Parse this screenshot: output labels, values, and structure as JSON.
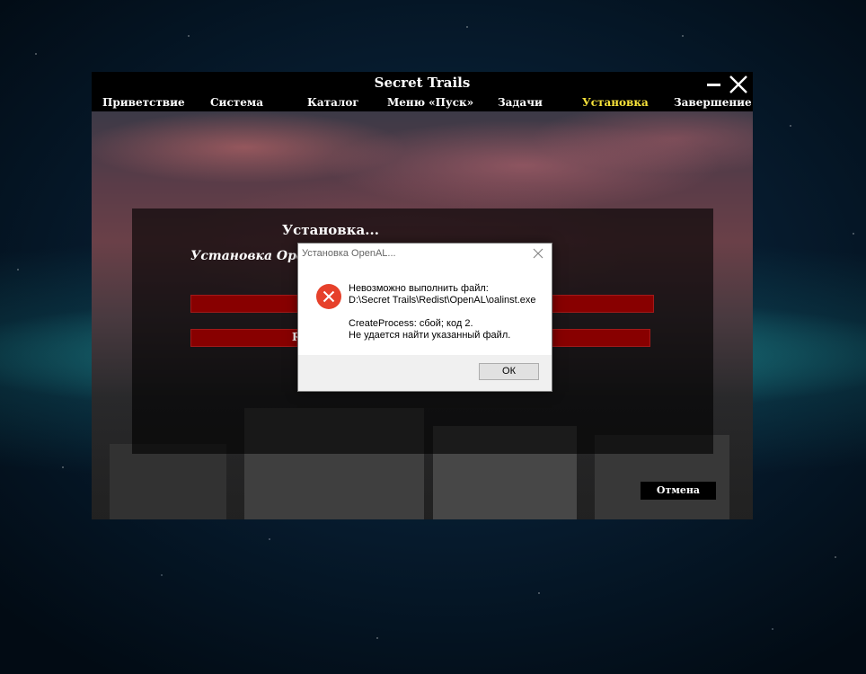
{
  "window": {
    "title": "Secret Trails"
  },
  "nav": {
    "items": [
      {
        "label": "Приветствие"
      },
      {
        "label": "Система"
      },
      {
        "label": "Каталог"
      },
      {
        "label": "Меню «Пуск»"
      },
      {
        "label": "Задачи"
      },
      {
        "label": "Установка"
      },
      {
        "label": "Завершение"
      }
    ],
    "active_index": 5
  },
  "content": {
    "heading": "Установка...",
    "subheading": "Установка Ope",
    "progress_2_text": "R"
  },
  "progress": {
    "bar1_fraction": 1.0,
    "bar2_fraction": 1.0
  },
  "cancel_label": "Отмена",
  "dialog": {
    "title": "Установка OpenAL...",
    "message_lines": [
      "Невозможно выполнить файл:",
      "D:\\Secret Trails\\Redist\\OpenAL\\oalinst.exe",
      "",
      "CreateProcess: сбой; код 2.",
      "Не удается найти указанный файл."
    ],
    "ok_label": "ОК"
  },
  "colors": {
    "accent_nav": "#f7e23a",
    "progress_red": "#7a0000",
    "error_red": "#e6412b"
  },
  "icons": {
    "close": "close-icon",
    "minimize": "minimize-icon",
    "error": "error-icon",
    "dialog_close": "close-icon"
  }
}
